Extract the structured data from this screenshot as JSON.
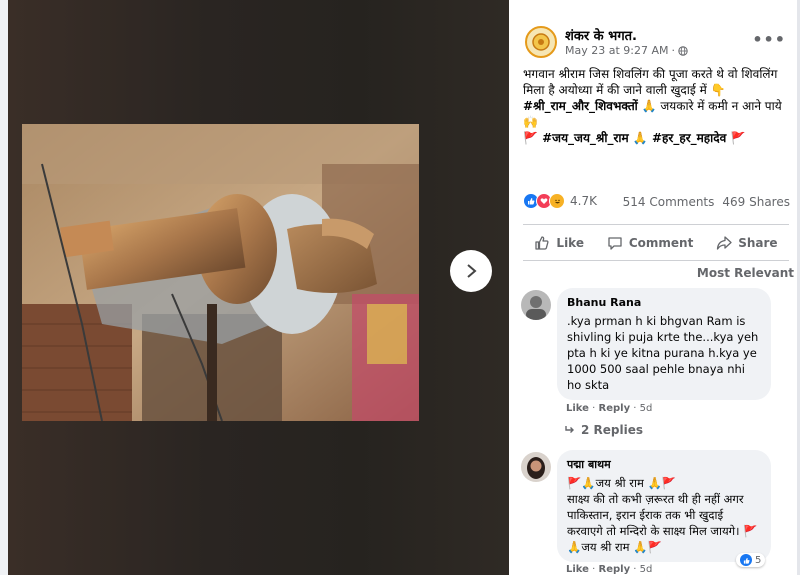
{
  "post": {
    "page_name": "शंकर के भगत.",
    "timestamp": "May 23 at 9:27 AM",
    "separator": "·",
    "audience_icon": "globe-icon",
    "more_label": "•••",
    "text_line1": "भगवान श्रीराम जिस शिवलिंग की पूजा करते थे वो शिवलिंग मिला है अयोध्या में की जाने वाली खुदाई में 👇",
    "text_line2_tag": "#श्री_राम_और_शिवभक्तों",
    "text_line2_rest": "🙏 जयकारे में कमी न आने पाये 🙌",
    "text_line3": "🚩 #जय_जय_श्री_राम 🙏 #हर_हर_महादेव 🚩"
  },
  "stats": {
    "reactions_count": "4.7K",
    "comments": "514 Comments",
    "shares": "469 Shares"
  },
  "actions": {
    "like": "Like",
    "comment": "Comment",
    "share": "Share"
  },
  "sort_label": "Most Relevant",
  "comments": [
    {
      "author": "Bhanu Rana",
      "text": ".kya prman h ki bhgvan Ram is shivling ki puja krte the...kya yeh pta h ki ye kitna purana h.kya ye 1000 500 saal pehle bnaya nhi ho skta",
      "like": "Like",
      "reply": "Reply",
      "age": "5d",
      "replies_label": "2 Replies"
    },
    {
      "author": "पद्मा बाथम",
      "line1": "🚩🙏जय श्री राम 🙏🚩",
      "text": "साक्ष्य की तो कभी ज़रूरत थी ही नहीं अगर पाकिस्तान, इरान ईराक तक भी खुदाई करवाएगे तो मन्दिरो के साक्ष्य मिल जायगे। 🚩🙏जय श्री राम 🙏🚩",
      "like": "Like",
      "reply": "Reply",
      "age": "5d",
      "like_count": "5"
    }
  ],
  "colors": {
    "fb_blue": "#1877f2",
    "secondary_text": "#65676b",
    "bubble_bg": "#f0f2f5"
  }
}
